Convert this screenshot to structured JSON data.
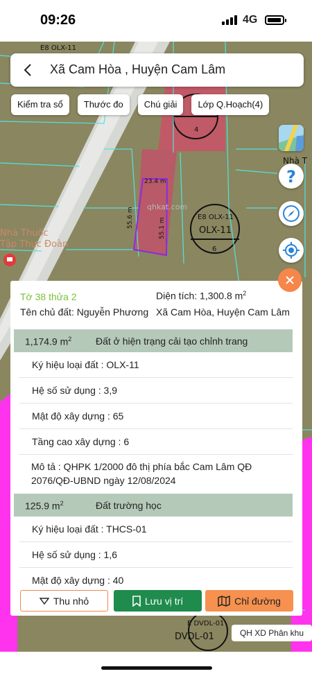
{
  "status_bar": {
    "time": "09:26",
    "network": "4G"
  },
  "header": {
    "title": "Xã Cam Hòa , Huyện Cam Lâm"
  },
  "toolbar": {
    "chips": [
      "Kiểm tra sổ",
      "Thước đo",
      "Chú giải",
      "Lớp Q.Hoạch(4)"
    ]
  },
  "map": {
    "labels": {
      "e8_top": "E8 OLX-11",
      "e8_mid": "E8 OLX-11",
      "olx": "OLX-11",
      "dim_top": "23.4 m",
      "dim_left": "55.6 m",
      "dim_right": "55.1 m",
      "watermark": "qhkat.com",
      "shop1": "Nhà Thuốc",
      "shop2": "Tập Thực Đoàn",
      "nha": "Nhà T",
      "dvdl": "E DVDL-01",
      "dvdl2": "DVDL-01",
      "num4": "4",
      "num6": "6"
    },
    "colors": {
      "residential": "#8a8660",
      "parcel_pink": "#c0606a",
      "magenta": "#ff33ee",
      "road": "#d5d8d2",
      "cyan_line": "#52e3e0",
      "selected": "#8a2be2"
    }
  },
  "panel": {
    "parcel": "Tờ 38 thửa 2",
    "area_label": "Diện tích:",
    "area_value": "1,300.8 m",
    "area_unit_sup": "2",
    "owner": "Tên chủ đất: Nguyễn Phương",
    "address": "Xã Cam Hòa, Huyện Cam Lâm",
    "sections": [
      {
        "amount": "1,174.9 m",
        "unit_sup": "2",
        "use": "Đất ở hiện trạng cải tạo chỉnh trang",
        "rows": [
          "Ký hiệu loại đất : OLX-11",
          "Hệ số sử dụng : 3,9",
          "Mật độ xây dựng : 65",
          "Tầng cao xây dựng : 6"
        ],
        "description": "Mô tả : QHPK 1/2000 đô thị phía bắc Cam Lâm QĐ 2076/QĐ-UBND ngày 12/08/2024"
      },
      {
        "amount": "125.9 m",
        "unit_sup": "2",
        "use": "Đất trường học",
        "rows": [
          "Ký hiệu loại đất : THCS-01",
          "Hệ số sử dụng : 1,6",
          "Mật độ xây dựng : 40"
        ]
      }
    ]
  },
  "actions": {
    "collapse": "Thu nhỏ",
    "save": "Lưu vị trí",
    "directions": "Chỉ đường"
  },
  "footer_tag": "QH XD Phân khu"
}
